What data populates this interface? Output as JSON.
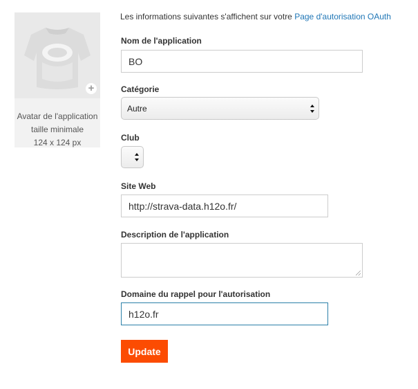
{
  "intro": {
    "text": "Les informations suivantes s'affichent sur votre",
    "link": "Page d'autorisation OAuth"
  },
  "avatar": {
    "caption_line1": "Avatar de l'application",
    "caption_line2": "taille minimale",
    "caption_line3": "124 x 124 px",
    "add_icon": "+"
  },
  "form": {
    "app_name": {
      "label": "Nom de l'application",
      "value": "BO"
    },
    "category": {
      "label": "Catégorie",
      "selected": "Autre"
    },
    "club": {
      "label": "Club",
      "selected": ""
    },
    "website": {
      "label": "Site Web",
      "value": "http://strava-data.h12o.fr/"
    },
    "description": {
      "label": "Description de l'application",
      "value": ""
    },
    "callback_domain": {
      "label": "Domaine du rappel pour l'autorisation",
      "value": "h12o.fr"
    }
  },
  "update_button": "Update",
  "colors": {
    "accent": "#fc4c02",
    "link": "#1f76b6",
    "focus_border": "#2a7fa8"
  },
  "icons": [
    "jersey-placeholder-icon",
    "plus-icon",
    "select-arrows-icon",
    "resize-grip-icon"
  ]
}
